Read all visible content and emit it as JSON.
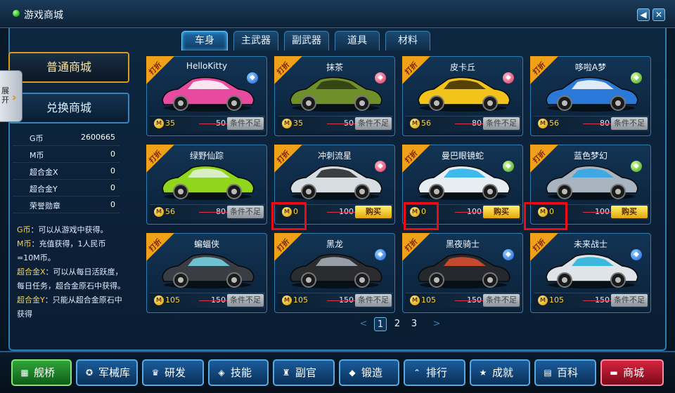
{
  "window": {
    "title": "游戏商城",
    "sound_icon": "speaker-icon",
    "close_icon": "close-icon"
  },
  "tabs": [
    {
      "label": "车身",
      "active": true
    },
    {
      "label": "主武器"
    },
    {
      "label": "副武器"
    },
    {
      "label": "道具"
    },
    {
      "label": "材料"
    }
  ],
  "sidebar": {
    "shop_normal": "普通商城",
    "shop_exchange": "兑换商城",
    "expand_label": "展开",
    "stats": [
      {
        "label": "G币",
        "value": "2600665"
      },
      {
        "label": "M币",
        "value": "0"
      },
      {
        "label": "超合金X",
        "value": "0"
      },
      {
        "label": "超合金Y",
        "value": "0"
      },
      {
        "label": "荣誉勋章",
        "value": "0"
      }
    ],
    "info": [
      {
        "hl": "G币",
        "text": "：可以从游戏中获得。"
      },
      {
        "hl": "M币",
        "text": "：充值获得，1人民币=10M币。"
      },
      {
        "hl": "超合金X",
        "text": "：可以从每日活跃度，每日任务，超合金原石中获得。"
      },
      {
        "hl": "超合金Y",
        "text": "：只能从超合金原石中获得"
      }
    ]
  },
  "discount_label": "打折",
  "currency_icon": "m-coin-icon",
  "cards": [
    {
      "name": "HelloKitty",
      "price": "35",
      "original": "50",
      "action": "条件不足",
      "buy": false,
      "badge": "b-blue",
      "body": "#e84aa0",
      "accent": "#ffffff"
    },
    {
      "name": "抹茶",
      "price": "35",
      "original": "50",
      "action": "条件不足",
      "buy": false,
      "badge": "b-red",
      "body": "#6f8f2a",
      "accent": "#2a3a10"
    },
    {
      "name": "皮卡丘",
      "price": "56",
      "original": "80",
      "action": "条件不足",
      "buy": false,
      "badge": "b-red",
      "body": "#f2c31b",
      "accent": "#3a2a00"
    },
    {
      "name": "哆啦A梦",
      "price": "56",
      "original": "80",
      "action": "条件不足",
      "buy": false,
      "badge": "b-green",
      "body": "#2a78d8",
      "accent": "#ffffff"
    },
    {
      "name": "绿野仙踪",
      "price": "56",
      "original": "80",
      "action": "条件不足",
      "buy": false,
      "badge": "",
      "body": "#8fd61c",
      "accent": "#e8f2e0"
    },
    {
      "name": "冲刺流星",
      "price": "0",
      "original": "100",
      "action": "购买",
      "buy": true,
      "badge": "b-red",
      "body": "#d8dde2",
      "accent": "#222"
    },
    {
      "name": "曼巴眼镜蛇",
      "price": "0",
      "original": "100",
      "action": "购买",
      "buy": true,
      "badge": "b-green",
      "body": "#e6eef4",
      "accent": "#1fb0e8"
    },
    {
      "name": "蓝色梦幻",
      "price": "0",
      "original": "100",
      "action": "购买",
      "buy": true,
      "badge": "b-green",
      "body": "#a8b4c0",
      "accent": "#2aa6e8"
    },
    {
      "name": "蝙蝠侠",
      "price": "105",
      "original": "150",
      "action": "条件不足",
      "buy": false,
      "badge": "",
      "body": "#3a3e44",
      "accent": "#7ad8e8"
    },
    {
      "name": "黑龙",
      "price": "105",
      "original": "150",
      "action": "条件不足",
      "buy": false,
      "badge": "b-blue",
      "body": "#2a2c30",
      "accent": "#aab2ba"
    },
    {
      "name": "黑夜骑士",
      "price": "105",
      "original": "150",
      "action": "条件不足",
      "buy": false,
      "badge": "b-blue",
      "body": "#25282c",
      "accent": "#e05030"
    },
    {
      "name": "未来战士",
      "price": "105",
      "original": "150",
      "action": "条件不足",
      "buy": false,
      "badge": "b-blue",
      "body": "#dfe4e8",
      "accent": "#1fb0d8"
    }
  ],
  "pagination": {
    "prev": "<",
    "pages": [
      "1",
      "2",
      "3"
    ],
    "current": "1",
    "next": ">"
  },
  "bottom_nav": [
    {
      "label": "舰桥",
      "icon": "flag-icon",
      "glyph": "▦"
    },
    {
      "label": "军械库",
      "icon": "gear-icon",
      "glyph": "✪"
    },
    {
      "label": "研发",
      "icon": "research-icon",
      "glyph": "♛"
    },
    {
      "label": "技能",
      "icon": "skill-icon",
      "glyph": "◈"
    },
    {
      "label": "副官",
      "icon": "officer-icon",
      "glyph": "♜"
    },
    {
      "label": "锻造",
      "icon": "forge-icon",
      "glyph": "◆"
    },
    {
      "label": "排行",
      "icon": "rank-icon",
      "glyph": "⌃"
    },
    {
      "label": "成就",
      "icon": "achievement-icon",
      "glyph": "★"
    },
    {
      "label": "百科",
      "icon": "encyclopedia-icon",
      "glyph": "▤"
    },
    {
      "label": "商城",
      "icon": "shop-icon",
      "glyph": "▬"
    }
  ]
}
